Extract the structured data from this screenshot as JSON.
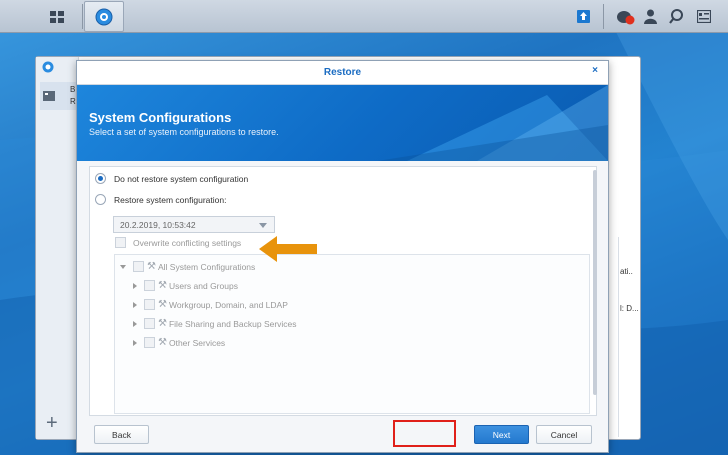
{
  "taskbar": {
    "main_menu_icon": "grid-icon",
    "app_icon": "backup-app-icon",
    "right_icons": [
      "upload-icon",
      "notification-icon",
      "user-icon",
      "search-icon",
      "widget-icon"
    ],
    "notification_count": "1"
  },
  "background_window": {
    "partial_label_1": "B",
    "partial_label_2": "R",
    "partial_text_1": "ati..",
    "partial_text_2": "l: D..."
  },
  "dialog": {
    "title": "Restore",
    "banner_title": "System Configurations",
    "banner_subtitle": "Select a set of system configurations to restore.",
    "options": [
      {
        "label": "Do not restore system configuration",
        "selected": true
      },
      {
        "label": "Restore system configuration:",
        "selected": false
      }
    ],
    "restore_point": "20.2.2019, 10:53:42",
    "overwrite_label": "Overwrite conflicting settings",
    "tree": {
      "root": "All System Configurations",
      "children": [
        "Users and Groups",
        "Workgroup, Domain, and LDAP",
        "File Sharing and Backup Services",
        "Other Services"
      ]
    },
    "buttons": {
      "back": "Back",
      "next": "Next",
      "cancel": "Cancel"
    }
  },
  "colors": {
    "accent": "#1b6cc2",
    "arrow": "#e8930c",
    "highlight": "#e0201a"
  }
}
